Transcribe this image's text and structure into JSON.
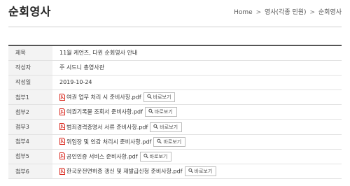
{
  "header": {
    "title": "순회영사",
    "breadcrumb": [
      "Home",
      "영사(각종 민원)",
      "순회영사"
    ],
    "separator": ">"
  },
  "table": {
    "rows": [
      {
        "label": "제목",
        "value": "11월 케언즈, 다윈 순회영사 안내"
      },
      {
        "label": "작성자",
        "value": "주 시드니 총영사관"
      },
      {
        "label": "작성일",
        "value": "2019-10-24"
      }
    ],
    "attachments": [
      {
        "label": "첨부1",
        "file": "여권 업무 처리 시 준비사항.pdf",
        "button": "바로보기"
      },
      {
        "label": "첨부2",
        "file": "여권기록물 조회서 준비사항.pdf",
        "button": "바로보기"
      },
      {
        "label": "첨부3",
        "file": "범죄경력증명서 서류 준비사항.pdf",
        "button": "바로보기"
      },
      {
        "label": "첨부4",
        "file": "위임장 및 인감 처리시 준비사항.pdf",
        "button": "바로보기"
      },
      {
        "label": "첨부5",
        "file": "공인인증 서비스 준비사항.pdf",
        "button": "바로보기"
      },
      {
        "label": "첨부6",
        "file": "한국운전면허증 갱신 및 재발급신청 준비사항.pdf",
        "button": "바로보기"
      }
    ]
  },
  "icons": {
    "pdf": "pdf-file-icon",
    "view": "magnifier-icon"
  },
  "colors": {
    "pdf_red": "#d9261c",
    "header_bg": "#f3f3f3",
    "top_border": "#555555"
  }
}
